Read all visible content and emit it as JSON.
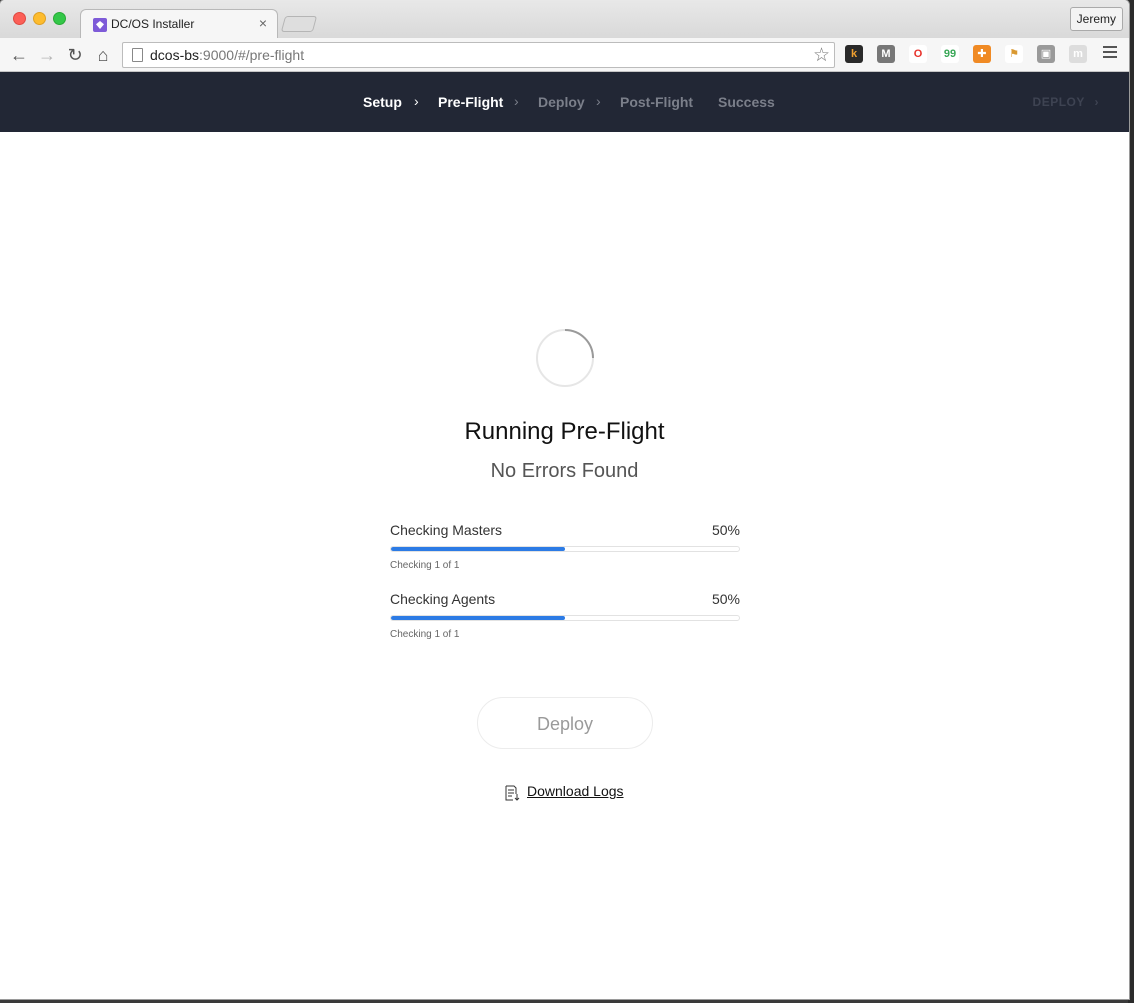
{
  "browser": {
    "tab_title": "DC/OS Installer",
    "tab_close": "×",
    "profile_name": "Jeremy",
    "url_host": "dcos-bs",
    "url_path": ":9000/#/pre-flight",
    "back_glyph": "←",
    "forward_glyph": "→",
    "reload_glyph": "↻",
    "home_glyph": "⌂",
    "star_glyph": "☆",
    "extensions": [
      {
        "name": "k-extension-icon",
        "label": "k",
        "bg": "#2a2a2a",
        "fg": "#f0a030"
      },
      {
        "name": "m-extension-icon",
        "label": "M",
        "bg": "#777777",
        "fg": "#ffffff"
      },
      {
        "name": "opera-extension-icon",
        "label": "O",
        "bg": "#ffffff",
        "fg": "#e8322b"
      },
      {
        "name": "hangouts-extension-icon",
        "label": "99",
        "bg": "#ffffff",
        "fg": "#3aa757"
      },
      {
        "name": "lifebuoy-extension-icon",
        "label": "✚",
        "bg": "#f08a24",
        "fg": "#ffffff"
      },
      {
        "name": "flag-extension-icon",
        "label": "⚑",
        "bg": "#ffffff",
        "fg": "#d99830"
      },
      {
        "name": "box-extension-icon",
        "label": "▣",
        "bg": "#9a9a9a",
        "fg": "#ffffff"
      },
      {
        "name": "m-circle-extension-icon",
        "label": "m",
        "bg": "#dddddd",
        "fg": "#ffffff"
      }
    ]
  },
  "nav": {
    "steps": [
      {
        "label": "Setup",
        "state": "done"
      },
      {
        "label": "Pre-Flight",
        "state": "active"
      },
      {
        "label": "Deploy",
        "state": "pending"
      },
      {
        "label": "Post-Flight",
        "state": "pending"
      },
      {
        "label": "Success",
        "state": "pending"
      }
    ],
    "separator": "›",
    "deploy_label": "DEPLOY",
    "deploy_chevron": "›"
  },
  "main": {
    "heading": "Running Pre-Flight",
    "subheading": "No Errors Found",
    "progress": [
      {
        "label": "Checking Masters",
        "percent_label": "50%",
        "percent": 50,
        "detail": "Checking 1 of 1"
      },
      {
        "label": "Checking Agents",
        "percent_label": "50%",
        "percent": 50,
        "detail": "Checking 1 of 1"
      }
    ],
    "deploy_button": "Deploy",
    "download_logs": "Download Logs"
  },
  "colors": {
    "nav_bg": "#222735",
    "progress_fill": "#2c7be5",
    "nav_inactive": "#7b7f8a"
  }
}
